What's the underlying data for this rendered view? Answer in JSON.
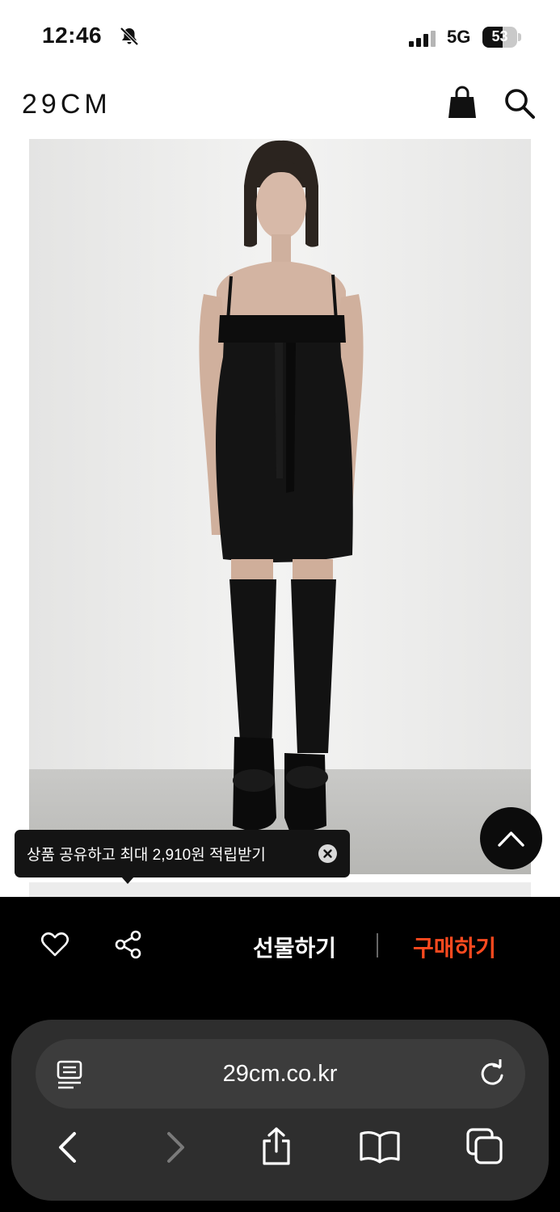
{
  "status_bar": {
    "time": "12:46",
    "network": "5G",
    "battery": "53"
  },
  "header": {
    "logo": "29CM"
  },
  "icons": {
    "mute": "bell-slash-icon",
    "signal": "signal-icon",
    "battery": "battery-icon",
    "cart": "shopping-bag-icon",
    "search": "search-icon",
    "close": "close-icon",
    "scroll_top": "chevron-up-icon",
    "wishlist": "heart-icon",
    "share": "share-icon",
    "reader": "reader-icon",
    "reload": "reload-icon",
    "back": "chevron-left-icon",
    "forward": "chevron-right-icon",
    "browser_share": "upload-icon",
    "bookmarks": "book-icon",
    "tabs": "tabs-icon"
  },
  "tooltip": {
    "text": "상품 공유하고 최대 2,910원 적립받기"
  },
  "action_bar": {
    "gift_label": "선물하기",
    "buy_label": "구매하기"
  },
  "browser": {
    "url": "29cm.co.kr"
  },
  "colors": {
    "accent": "#ff4a1f",
    "bar_bg": "#000000",
    "chrome_bg": "#2e2e2e"
  }
}
